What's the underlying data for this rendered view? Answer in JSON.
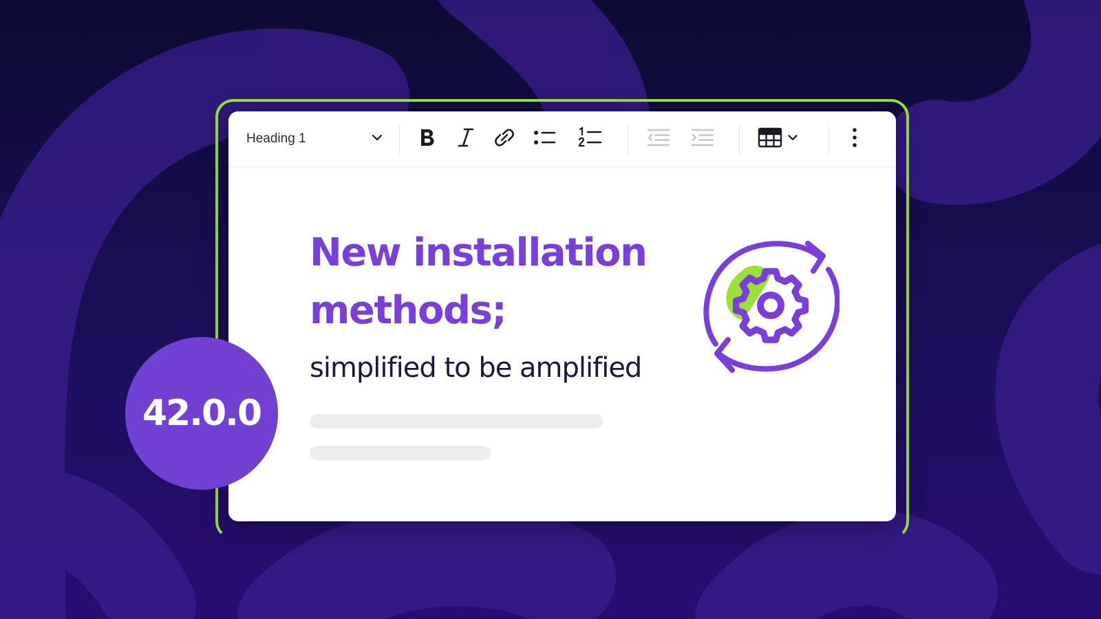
{
  "colors": {
    "background": "#150d45",
    "accent_purple": "#7b3fd9",
    "accent_green": "#9ce036",
    "badge": "#7340d4",
    "subtitle_text": "#1c1838"
  },
  "toolbar": {
    "heading_select": {
      "value": "Heading 1",
      "icon": "chevron-down-icon"
    },
    "buttons": [
      {
        "name": "bold",
        "icon": "bold-icon"
      },
      {
        "name": "italic",
        "icon": "italic-icon"
      },
      {
        "name": "link",
        "icon": "link-icon"
      },
      {
        "name": "bulleted-list",
        "icon": "bulleted-list-icon"
      },
      {
        "name": "numbered-list",
        "icon": "numbered-list-icon"
      },
      {
        "name": "outdent",
        "icon": "outdent-icon",
        "disabled": true
      },
      {
        "name": "indent",
        "icon": "indent-icon",
        "disabled": true
      },
      {
        "name": "insert-table",
        "icon": "table-icon"
      },
      {
        "name": "more",
        "icon": "vertical-dots-icon"
      }
    ]
  },
  "content": {
    "title_line1": "New installation",
    "title_line2": "methods;",
    "subtitle": "simplified to be amplified",
    "graphic_icon": "gear-refresh-icon"
  },
  "badge": {
    "version": "42.0.0"
  }
}
